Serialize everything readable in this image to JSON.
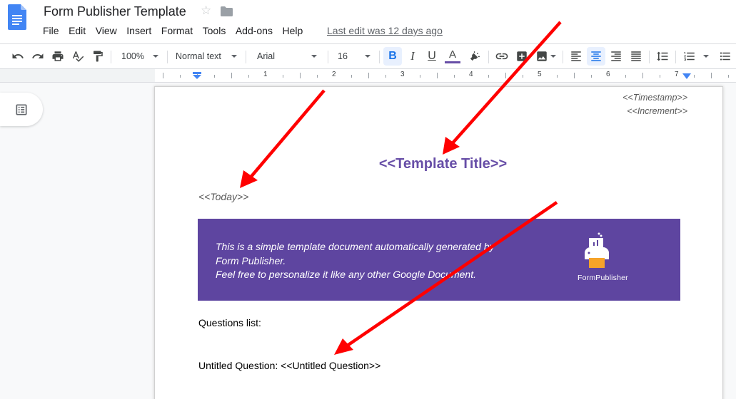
{
  "app": {
    "title": "Form Publisher Template",
    "last_edit": "Last edit was 12 days ago"
  },
  "menu": [
    "File",
    "Edit",
    "View",
    "Insert",
    "Format",
    "Tools",
    "Add-ons",
    "Help"
  ],
  "toolbar": {
    "zoom": "100%",
    "style": "Normal text",
    "font": "Arial",
    "font_size": "16",
    "text_color": "#674ea7",
    "active_alignment": "center",
    "bold_active": true
  },
  "ruler": {
    "labels": [
      "1",
      "2",
      "3",
      "4",
      "5",
      "6",
      "7"
    ]
  },
  "document": {
    "header": {
      "timestamp": "<<Timestamp>>",
      "increment": "<<Increment>>"
    },
    "title": "<<Template Title>>",
    "today": "<<Today>>",
    "banner": {
      "line1": "This is a simple template document automatically generated by",
      "line2": "Form Publisher.",
      "line3": "Feel free to personalize it like any other Google Document.",
      "logo_label": "FormPublisher",
      "color": "#5e45a0"
    },
    "questions_label": "Questions list:",
    "question_item": "Untitled Question: <<Untitled Question>>"
  },
  "annotations": {
    "arrow_color": "#ff0000",
    "arrow_count": 3
  }
}
